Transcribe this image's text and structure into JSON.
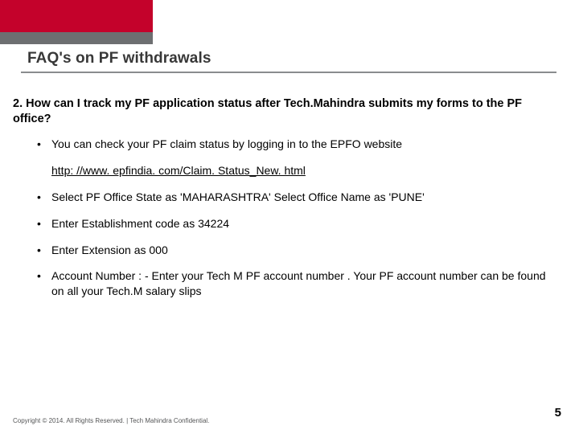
{
  "title": "FAQ's on PF withdrawals",
  "question": "2.  How can I track my PF application status after Tech.Mahindra submits my forms to the PF office?",
  "bullets": [
    "You can check your PF claim status by logging in to the EPFO website",
    "http: //www. epfindia. com/Claim. Status_New. html",
    "Select PF Office State as 'MAHARASHTRA' Select Office Name as 'PUNE'",
    "Enter Establishment code as 34224",
    "Enter Extension as 000",
    "Account Number : - Enter your Tech M PF account number . Your PF account number can be found on all your Tech.M salary slips"
  ],
  "copyright": "Copyright © 2014. All Rights Reserved.  |  Tech Mahindra Confidential.",
  "page_number": "5"
}
